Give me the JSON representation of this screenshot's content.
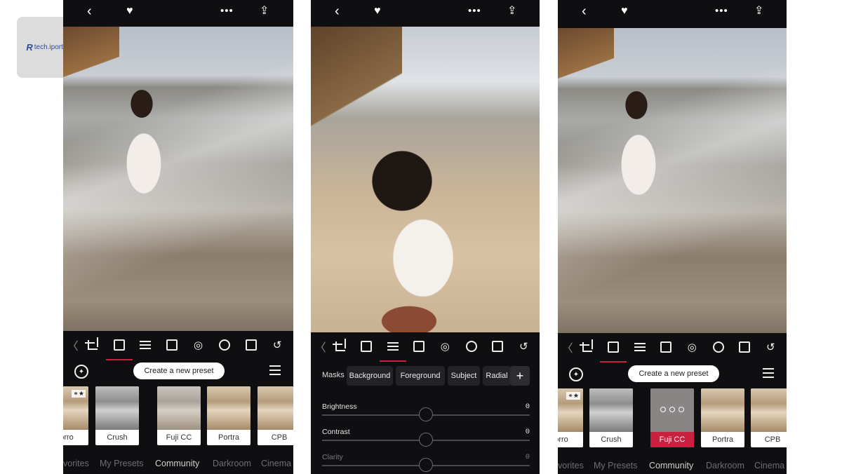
{
  "logo": {
    "mark": "R",
    "text": "tech.iportal"
  },
  "panels": {
    "left": {
      "status": {
        "back": "‹",
        "heart": "♥",
        "more": "•••",
        "share": "⇪"
      },
      "create_preset_label": "Create a new preset",
      "thumbs": [
        "orro",
        "Crush",
        "Fuji CC",
        "Portra",
        "CPB"
      ],
      "tabs": [
        "vorites",
        "My Presets",
        "Community",
        "Darkroom",
        "Cinema"
      ],
      "active_tab": "Community"
    },
    "middle": {
      "status": {
        "back": "‹",
        "heart": "♥",
        "more": "•••",
        "share": "⇪"
      },
      "masks_label": "Masks",
      "mask_chips": [
        "Background",
        "Foreground",
        "Subject",
        "Radial"
      ],
      "add_label": "+",
      "adjustments": [
        {
          "name": "Brightness",
          "value": "0",
          "level": 0.5
        },
        {
          "name": "Contrast",
          "value": "0",
          "level": 0.5
        },
        {
          "name": "Clarity",
          "value": "0",
          "level": 0.5
        }
      ]
    },
    "right": {
      "status": {
        "back": "‹",
        "heart": "♥",
        "more": "•••",
        "share": "⇪"
      },
      "create_preset_label": "Create a new preset",
      "thumbs": [
        "orro",
        "Crush",
        "Fuji CC",
        "Portra",
        "CPB"
      ],
      "selected_thumb": "Fuji CC",
      "tabs": [
        "vorites",
        "My Presets",
        "Community",
        "Darkroom",
        "Cinema"
      ],
      "active_tab": "Community"
    }
  },
  "toolbar_icons": [
    "chevron-left-icon",
    "crop-icon",
    "image-icon",
    "sliders-icon",
    "curves-icon",
    "color-mix-icon",
    "lens-icon",
    "frame-icon",
    "history-icon"
  ],
  "colors": {
    "accent": "#c7213f",
    "app_bg": "#0f0e11"
  }
}
